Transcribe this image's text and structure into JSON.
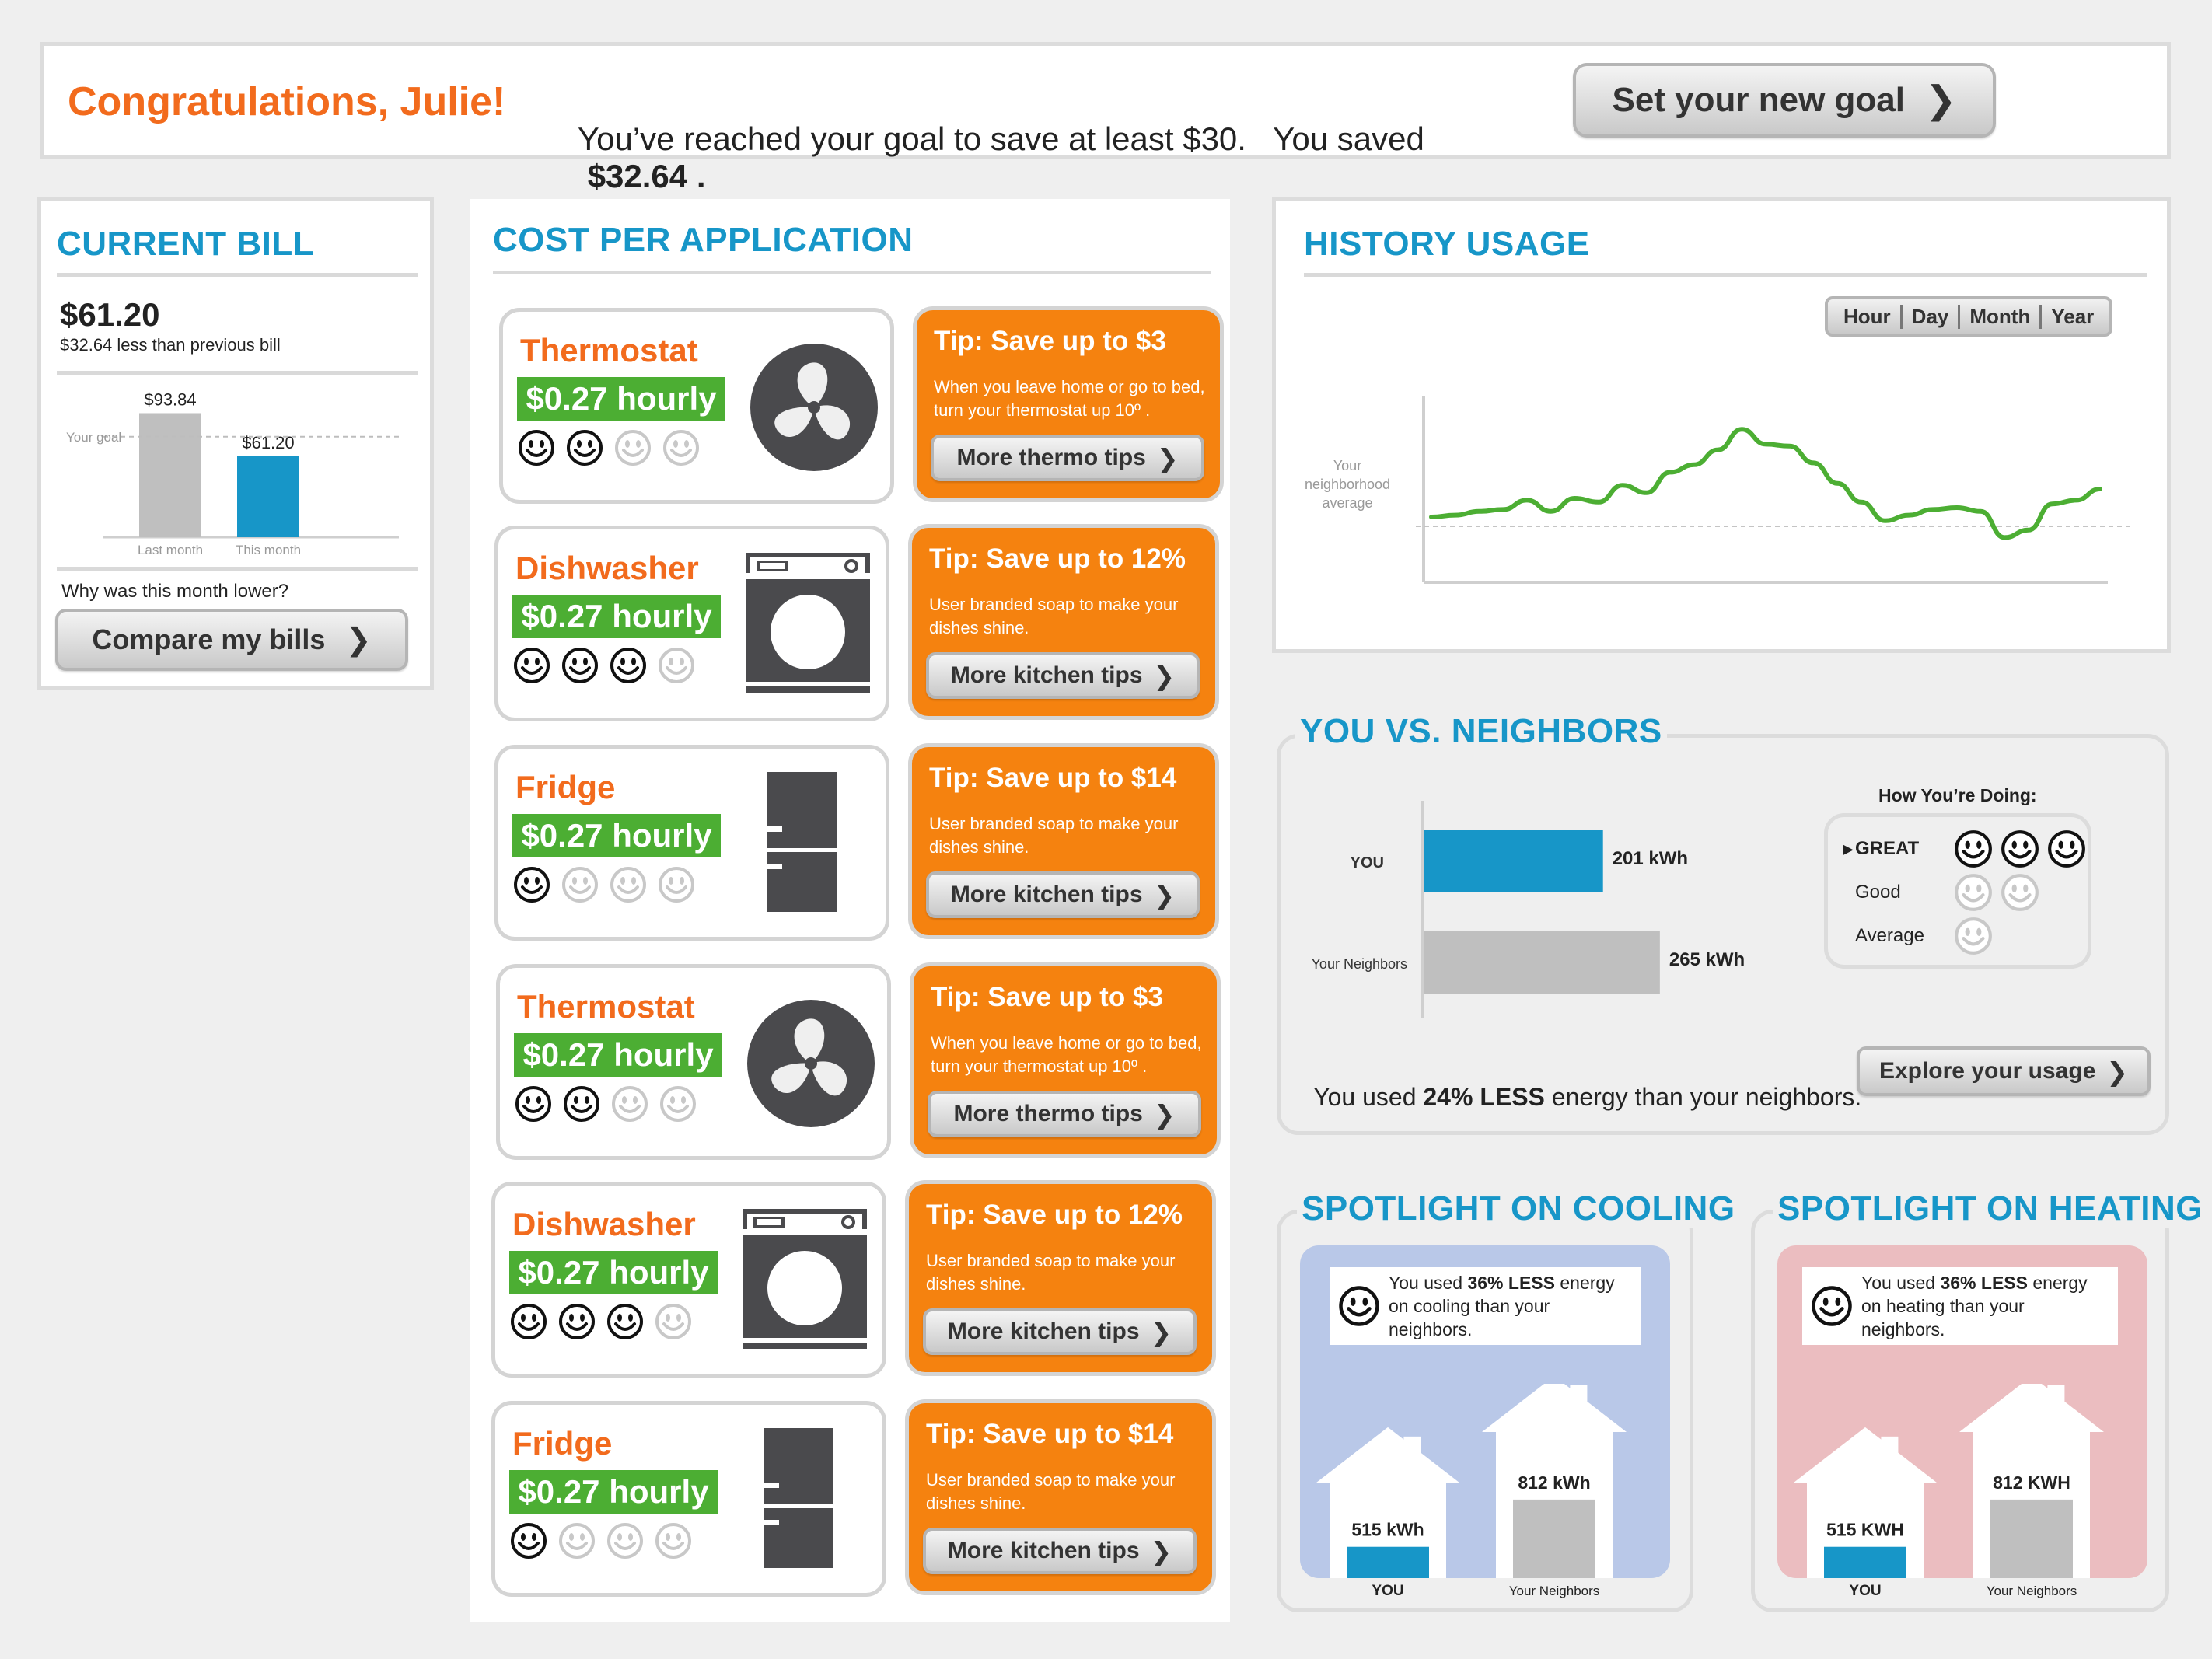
{
  "banner": {
    "congrats": "Congratulations, Julie!",
    "message": "You’ve reached your goal to save at least $30.   You saved",
    "saved_amount": "$32.64 .",
    "button_label": "Set your new goal"
  },
  "current_bill": {
    "title": "CURRENT BILL",
    "amount": "$61.20",
    "comparison": "$32.64 less than previous bill",
    "chart_data": {
      "type": "bar",
      "categories": [
        "Last month",
        "This month"
      ],
      "values": [
        93.84,
        61.2
      ],
      "data_labels": [
        "$93.84",
        "$61.20"
      ],
      "goal_label": "Your goal",
      "goal_value": 76,
      "ylim": [
        0,
        100
      ],
      "colors": [
        "#bfbfbf",
        "#1796c8"
      ]
    },
    "why_lower": "Why was this month lower?",
    "button_label": "Compare my bills"
  },
  "cost_per_application": {
    "title": "COST PER APPLICATION",
    "items": [
      {
        "name": "Thermostat",
        "price": "$0.27 hourly",
        "rating": 2,
        "icon": "fan-icon",
        "tip_head": "Tip:  Save up to $3",
        "tip_body": "When you leave home or go to bed, turn your thermostat up 10º .",
        "tip_button": "More thermo tips"
      },
      {
        "name": "Dishwasher",
        "price": "$0.27 hourly",
        "rating": 3,
        "icon": "dishwasher-icon",
        "tip_head": "Tip:  Save up to 12%",
        "tip_body": "User branded soap to make your dishes shine.",
        "tip_button": "More kitchen tips"
      },
      {
        "name": "Fridge",
        "price": "$0.27 hourly",
        "rating": 1,
        "icon": "fridge-icon",
        "tip_head": "Tip:  Save up to $14",
        "tip_body": "User branded soap to make your dishes shine.",
        "tip_button": "More kitchen tips"
      },
      {
        "name": "Thermostat",
        "price": "$0.27 hourly",
        "rating": 2,
        "icon": "fan-icon",
        "tip_head": "Tip:  Save up to $3",
        "tip_body": "When you leave home or go to bed, turn your thermostat up 10º .",
        "tip_button": "More thermo tips"
      },
      {
        "name": "Dishwasher",
        "price": "$0.27 hourly",
        "rating": 3,
        "icon": "dishwasher-icon",
        "tip_head": "Tip:  Save up to 12%",
        "tip_body": "User branded soap to make your dishes shine.",
        "tip_button": "More kitchen tips"
      },
      {
        "name": "Fridge",
        "price": "$0.27 hourly",
        "rating": 1,
        "icon": "fridge-icon",
        "tip_head": "Tip:  Save up to $14",
        "tip_body": "User branded soap to make your dishes shine.",
        "tip_button": "More kitchen tips"
      }
    ]
  },
  "history_usage": {
    "title": "HISTORY USAGE",
    "tabs": [
      "Hour",
      "Day",
      "Month",
      "Year"
    ],
    "chart_data": {
      "type": "line",
      "series": [
        {
          "values": [
            0.5,
            0.6,
            0.8,
            0.9,
            1.4,
            0.8,
            1.5,
            1.3,
            2.2,
            1.8,
            2.9,
            3.3,
            4.1,
            5.2,
            4.4,
            4.3,
            3.4,
            2.3,
            1.3,
            0.3,
            0.6,
            0.9,
            1.0,
            0.8,
            -0.6,
            -0.2,
            1.2,
            1.4,
            2.0
          ]
        }
      ],
      "reference_line": {
        "label": "Your neighborhood average",
        "value": 0
      },
      "ylim": [
        -3,
        7
      ],
      "grid": false,
      "color": "#4cae33"
    }
  },
  "neighbors": {
    "title": "YOU VS. NEIGHBORS",
    "chart_data": {
      "type": "bar",
      "orientation": "horizontal",
      "categories": [
        "YOU",
        "Your Neighbors"
      ],
      "values": [
        201,
        265
      ],
      "data_labels": [
        "201 kWh",
        "265 kWh"
      ],
      "xlim": [
        0,
        420
      ],
      "colors": [
        "#1796c8",
        "#bfbfbf"
      ]
    },
    "doing_title": "How You’re Doing:",
    "levels": [
      {
        "label": "GREAT",
        "count": 3,
        "current": true
      },
      {
        "label": "Good",
        "count": 2,
        "current": false
      },
      {
        "label": "Average",
        "count": 1,
        "current": false
      }
    ],
    "summary_pre": "You used ",
    "summary_bold": "24% LESS",
    "summary_post": " energy than your neighbors.",
    "button_label": "Explore your usage"
  },
  "cooling": {
    "title": "SPOTLIGHT ON COOLING",
    "msg_pre": "You used ",
    "msg_bold": "36% LESS",
    "msg_post": " energy on cooling than your neighbors.",
    "chart_data": {
      "type": "bar",
      "categories": [
        "YOU",
        "Your Neighbors"
      ],
      "values": [
        515,
        812
      ],
      "data_labels": [
        "515 kWh",
        "812 kWh"
      ],
      "colors": [
        "#1796c8",
        "#bfbfbf"
      ]
    },
    "bg": "#b9c8e8"
  },
  "heating": {
    "title": "SPOTLIGHT ON HEATING",
    "msg_pre": "You used ",
    "msg_bold": "36% LESS",
    "msg_post": " energy on heating than your neighbors.",
    "chart_data": {
      "type": "bar",
      "categories": [
        "YOU",
        "Your Neighbors"
      ],
      "values": [
        515,
        812
      ],
      "data_labels": [
        "515 KWH",
        "812 KWH"
      ],
      "colors": [
        "#1796c8",
        "#bfbfbf"
      ]
    },
    "bg": "#ebbdc0"
  }
}
